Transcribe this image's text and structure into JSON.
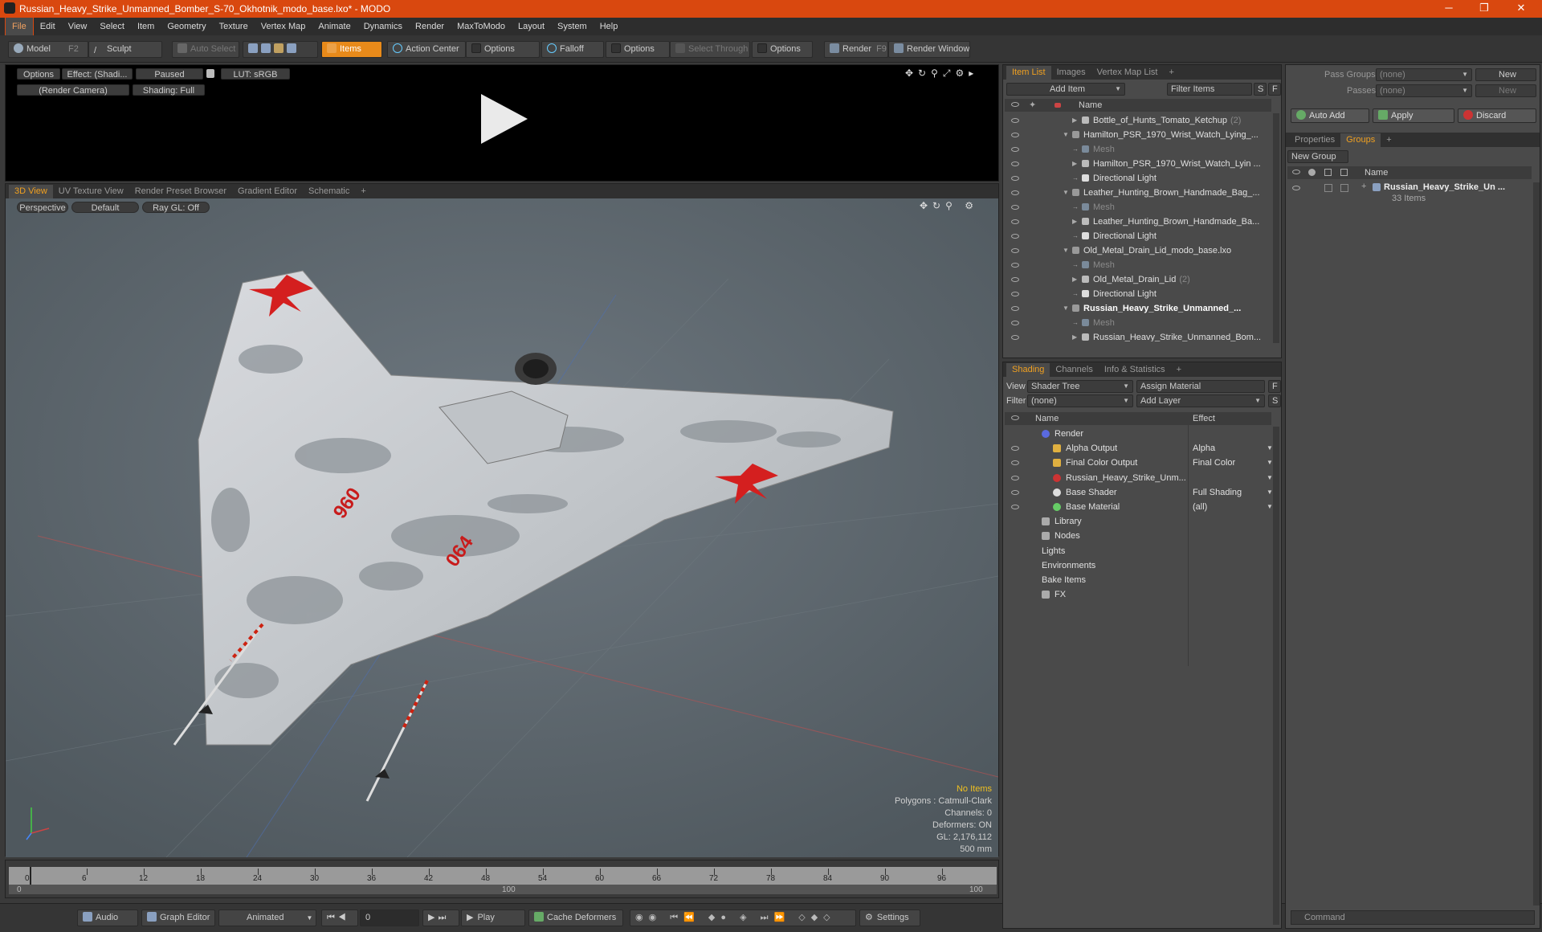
{
  "window": {
    "title": "Russian_Heavy_Strike_Unmanned_Bomber_S-70_Okhotnik_modo_base.lxo* - MODO",
    "min": "─",
    "max": "❐",
    "close": "✕"
  },
  "menu": [
    "File",
    "Edit",
    "View",
    "Select",
    "Item",
    "Geometry",
    "Texture",
    "Vertex Map",
    "Animate",
    "Dynamics",
    "Render",
    "MaxToModo",
    "Layout",
    "System",
    "Help"
  ],
  "toolbar": {
    "model": "Model",
    "model_key": "F2",
    "sculpt": "Sculpt",
    "auto_select": "Auto Select",
    "items": "Items",
    "action_center": "Action Center",
    "options1": "Options",
    "falloff": "Falloff",
    "options2": "Options",
    "select_through": "Select Through",
    "options3": "Options",
    "render": "Render",
    "render_key": "F9",
    "render_window": "Render Window"
  },
  "preview": {
    "options": "Options",
    "effect": "Effect: (Shadi...",
    "paused": "Paused",
    "lut": "LUT: sRGB",
    "camera": "(Render Camera)",
    "shading": "Shading: Full"
  },
  "viewport_tabs": [
    "3D View",
    "UV Texture View",
    "Render Preset Browser",
    "Gradient Editor",
    "Schematic",
    "+"
  ],
  "viewport": {
    "perspective": "Perspective",
    "default": "Default",
    "raygl": "Ray GL: Off",
    "stats": {
      "no_items": "No Items",
      "polygons": "Polygons : Catmull-Clark",
      "channels": "Channels: 0",
      "deformers": "Deformers: ON",
      "gl": "GL: 2,176,112",
      "scale": "500 mm"
    },
    "markings": [
      "960",
      "064"
    ]
  },
  "timeline": {
    "ticks": [
      "0",
      "6",
      "12",
      "18",
      "24",
      "30",
      "36",
      "42",
      "48",
      "54",
      "60",
      "66",
      "72",
      "78",
      "84",
      "90",
      "96"
    ],
    "lower": [
      "0",
      "100",
      "100"
    ]
  },
  "bottombar": {
    "audio": "Audio",
    "graph_editor": "Graph Editor",
    "animated": "Animated",
    "frame": "0",
    "play": "Play",
    "cache": "Cache Deformers",
    "settings": "Settings"
  },
  "itemlist": {
    "tabs": [
      "Item List",
      "Images",
      "Vertex Map List",
      "+"
    ],
    "add_item": "Add Item",
    "filter_items": "Filter Items",
    "s": "S",
    "f": "F",
    "col_name": "Name",
    "rows": [
      {
        "label": "Bottle_of_Hunts_Tomato_Ketchup",
        "count": "(2)",
        "indent": 2,
        "type": "item",
        "bold": false,
        "dim": false
      },
      {
        "label": "Hamilton_PSR_1970_Wrist_Watch_Lying_...",
        "count": "",
        "indent": 1,
        "type": "scene",
        "bold": false,
        "dim": false
      },
      {
        "label": "Mesh",
        "count": "",
        "indent": 2,
        "type": "mesh",
        "bold": false,
        "dim": true
      },
      {
        "label": "Hamilton_PSR_1970_Wrist_Watch_Lyin ...",
        "count": "",
        "indent": 2,
        "type": "item",
        "bold": false,
        "dim": false
      },
      {
        "label": "Directional Light",
        "count": "",
        "indent": 2,
        "type": "light",
        "bold": false,
        "dim": false
      },
      {
        "label": "Leather_Hunting_Brown_Handmade_Bag_...",
        "count": "",
        "indent": 1,
        "type": "scene",
        "bold": false,
        "dim": false
      },
      {
        "label": "Mesh",
        "count": "",
        "indent": 2,
        "type": "mesh",
        "bold": false,
        "dim": true
      },
      {
        "label": "Leather_Hunting_Brown_Handmade_Ba...",
        "count": "",
        "indent": 2,
        "type": "item",
        "bold": false,
        "dim": false
      },
      {
        "label": "Directional Light",
        "count": "",
        "indent": 2,
        "type": "light",
        "bold": false,
        "dim": false
      },
      {
        "label": "Old_Metal_Drain_Lid_modo_base.lxo",
        "count": "",
        "indent": 1,
        "type": "scene",
        "bold": false,
        "dim": false
      },
      {
        "label": "Mesh",
        "count": "",
        "indent": 2,
        "type": "mesh",
        "bold": false,
        "dim": true
      },
      {
        "label": "Old_Metal_Drain_Lid",
        "count": "(2)",
        "indent": 2,
        "type": "item",
        "bold": false,
        "dim": false
      },
      {
        "label": "Directional Light",
        "count": "",
        "indent": 2,
        "type": "light",
        "bold": false,
        "dim": false
      },
      {
        "label": "Russian_Heavy_Strike_Unmanned_...",
        "count": "",
        "indent": 1,
        "type": "scene",
        "bold": true,
        "dim": false
      },
      {
        "label": "Mesh",
        "count": "",
        "indent": 2,
        "type": "mesh",
        "bold": false,
        "dim": true
      },
      {
        "label": "Russian_Heavy_Strike_Unmanned_Bom...",
        "count": "",
        "indent": 2,
        "type": "item",
        "bold": false,
        "dim": false
      }
    ]
  },
  "shading": {
    "tabs": [
      "Shading",
      "Channels",
      "Info & Statistics",
      "+"
    ],
    "view_label": "View",
    "view_value": "Shader Tree",
    "assign_material": "Assign Material",
    "filter_label": "Filter",
    "filter_value": "(none)",
    "add_layer": "Add Layer",
    "f": "F",
    "s": "S",
    "col_name": "Name",
    "col_effect": "Effect",
    "rows": [
      {
        "label": "Render",
        "effect": "",
        "indent": 0,
        "icon": "render"
      },
      {
        "label": "Alpha Output",
        "effect": "Alpha",
        "indent": 1,
        "icon": "output"
      },
      {
        "label": "Final Color Output",
        "effect": "Final Color",
        "indent": 1,
        "icon": "output"
      },
      {
        "label": "Russian_Heavy_Strike_Unm...",
        "effect": "",
        "indent": 1,
        "icon": "mask"
      },
      {
        "label": "Base Shader",
        "effect": "Full Shading",
        "indent": 1,
        "icon": "shader"
      },
      {
        "label": "Base Material",
        "effect": "(all)",
        "indent": 1,
        "icon": "material"
      },
      {
        "label": "Library",
        "effect": "",
        "indent": 0,
        "icon": "folder"
      },
      {
        "label": "Nodes",
        "effect": "",
        "indent": 0,
        "icon": "folder"
      },
      {
        "label": "Lights",
        "effect": "",
        "indent": 0,
        "icon": "none"
      },
      {
        "label": "Environments",
        "effect": "",
        "indent": 0,
        "icon": "none"
      },
      {
        "label": "Bake Items",
        "effect": "",
        "indent": 0,
        "icon": "none"
      },
      {
        "label": "FX",
        "effect": "",
        "indent": 0,
        "icon": "fx"
      }
    ]
  },
  "right": {
    "pass_groups": "Pass Groups",
    "pass_groups_value": "(none)",
    "new": "New",
    "passes": "Passes",
    "passes_value": "(none)",
    "new2": "New",
    "auto_add": "Auto Add",
    "apply": "Apply",
    "discard": "Discard",
    "tabs": [
      "Properties",
      "Groups",
      "+"
    ],
    "new_group": "New Group",
    "col_name": "Name",
    "group_name": "Russian_Heavy_Strike_Un ...",
    "group_count": "33 Items",
    "command": "Command"
  },
  "colors": {
    "accent": "#d9480f",
    "tab_active": "#f0a020",
    "star": "#d41f1f"
  }
}
